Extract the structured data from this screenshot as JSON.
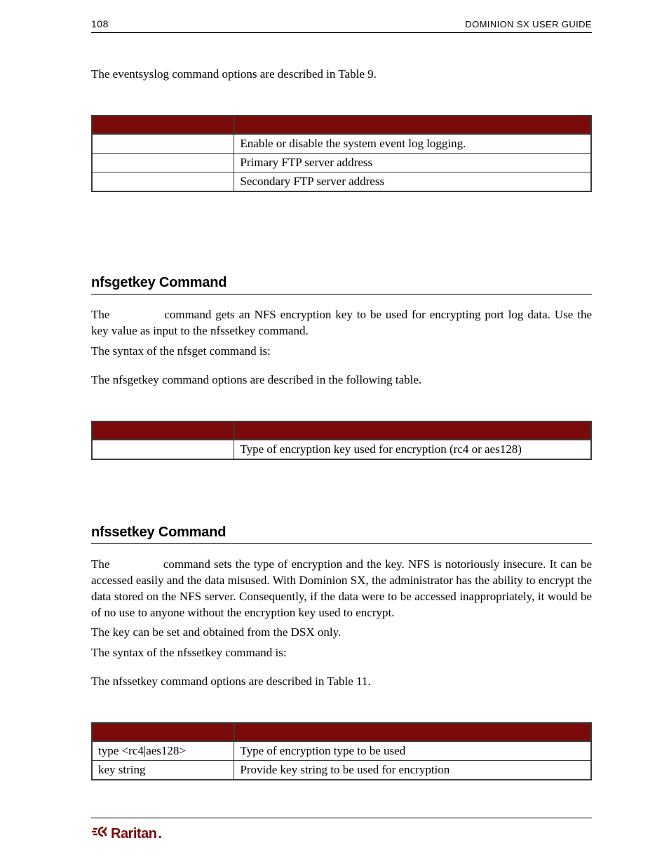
{
  "header": {
    "page_number": "108",
    "title": "DOMINION SX USER GUIDE"
  },
  "intro_line": "The eventsyslog command options are described in Table 9.",
  "table9": {
    "rows": [
      {
        "opt": "",
        "desc": "Enable or disable the system event log logging."
      },
      {
        "opt": "",
        "desc": "Primary FTP server address"
      },
      {
        "opt": "",
        "desc": "Secondary FTP server address"
      }
    ]
  },
  "section_nfsgetkey": {
    "title": "nfsgetkey Command",
    "p1a": "The ",
    "p1b": " command gets an NFS encryption key to be used for encrypting port log data. Use the key value as input to the nfssetkey command.",
    "p2": "The syntax of the nfsget command is:",
    "p3": "The nfsgetkey command options are described in the following table."
  },
  "table_nfsgetkey": {
    "rows": [
      {
        "opt": "",
        "desc": "Type of encryption key used for encryption (rc4 or aes128)"
      }
    ]
  },
  "section_nfssetkey": {
    "title": "nfssetkey Command",
    "p1a": "The ",
    "p1b": " command sets the type of encryption and the key. NFS is notoriously insecure. It can be accessed easily and the data misused. With Dominion SX, the administrator has the ability to encrypt the data stored on the NFS server. Consequently, if the data were to be accessed inappropriately, it would be of no use to anyone without the encryption key used to encrypt.",
    "p2": "The key can be set and obtained from the DSX only.",
    "p3": "The syntax of the nfssetkey command is:",
    "p4": "The nfssetkey command options are described in Table 11."
  },
  "table11": {
    "rows": [
      {
        "opt": "type <rc4|aes128>",
        "desc": "Type of encryption type to be used"
      },
      {
        "opt": "key string",
        "desc": "Provide key string to be used for encryption"
      }
    ]
  },
  "footer": {
    "brand": "Raritan"
  }
}
